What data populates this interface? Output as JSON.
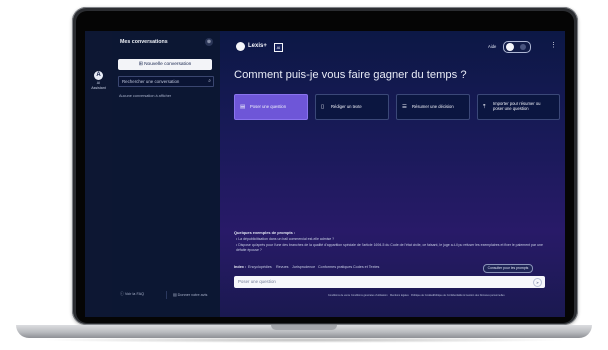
{
  "rail": {
    "icon": "A",
    "label_line1": "AI",
    "label_line2": "Assistant"
  },
  "sidebar": {
    "title": "Mes conversations",
    "close_icon": "⊗",
    "new_conversation": "Nouvelle conversation",
    "search_placeholder": "Rechercher une conversation",
    "empty_text": "Aucune conversation à afficher",
    "faq_link": "Voir la FAQ",
    "feedback_link": "Donner votre avis"
  },
  "header": {
    "logo_text": "Lexis+",
    "logo_badge": "AI",
    "help_label": "Aide"
  },
  "headline": "Comment puis-je vous faire gagner du temps ?",
  "cards": [
    {
      "label": "Poser une question",
      "icon": "chat-icon",
      "active": true
    },
    {
      "label": "Rédiger un texte",
      "icon": "document-icon",
      "active": false
    },
    {
      "label": "Résumer une décision",
      "icon": "list-icon",
      "active": false
    },
    {
      "label": "Importer pour résumer ou poser une question",
      "icon": "upload-icon",
      "active": false
    }
  ],
  "examples": {
    "title": "Quelques exemples de prompts :",
    "items": [
      "•  La dépublicitisation dans un bail commercial est-elle admise ?",
      "•  Dispose qu'après pour l'une des branches de la qualité d'apparition spéciale de l'article 1694-5 du Code de l'état civile, ce faisant, le juge a-t-il pu refuser les exemplaires et fixer le paiement par une défaite épouse ?"
    ]
  },
  "index": {
    "label": "Index :",
    "items": [
      "Encyclopédies",
      "Revues",
      "Jurisprudence",
      "Conformes pratiques",
      "Codes et Textes"
    ],
    "consult_button": "Consulter pour les prompts"
  },
  "ask": {
    "placeholder": "Poser une question",
    "send_icon": "send-icon"
  },
  "legal_links": [
    "Conditions de vente",
    "Conditions générales d'utilisation",
    "Mentions légales",
    "Politique de Cookies",
    "Politique de Confidentialité & Gestion des Données personnelles"
  ],
  "colors": {
    "accent": "#6e56d8",
    "background": "#0c1845",
    "sidebar": "#0c1733"
  }
}
